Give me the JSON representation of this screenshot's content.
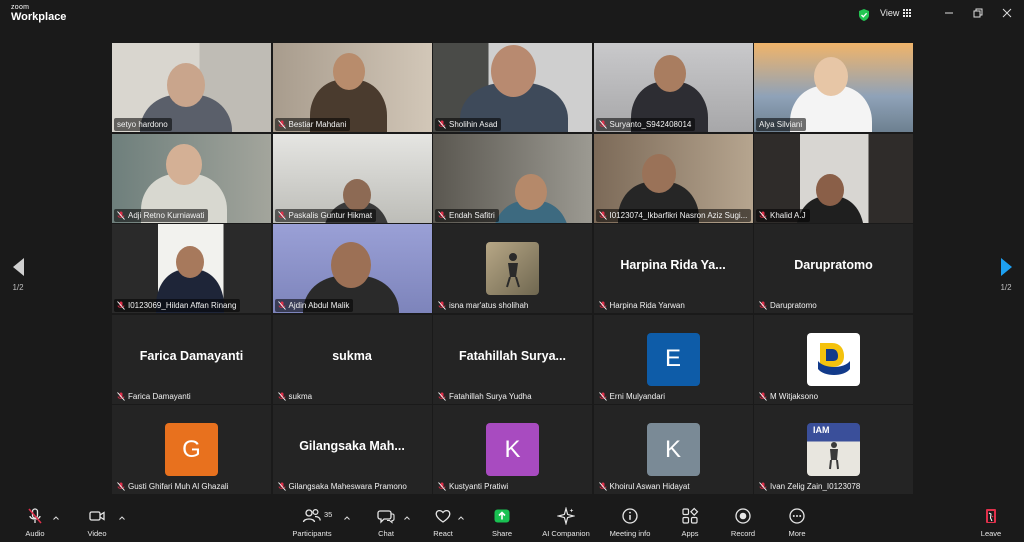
{
  "app": {
    "brand_small": "zoom",
    "brand_large": "Workplace",
    "view_label": "View"
  },
  "pager": {
    "left_label": "1/2",
    "right_label": "1/2"
  },
  "gallery": {
    "tiles": [
      {
        "name": "setyo hardono",
        "kind": "video",
        "muted": false,
        "bg": "#8a8a8a"
      },
      {
        "name": "Bestiar Mahdani",
        "kind": "video",
        "muted": true,
        "bg": "#7b6f62"
      },
      {
        "name": "Sholihin Asad",
        "kind": "video",
        "muted": true,
        "bg": "#6d6d6d"
      },
      {
        "name": "Suryanto_S942408014",
        "kind": "video",
        "muted": true,
        "bg": "#8d8d8f"
      },
      {
        "name": "Alya Silviani",
        "kind": "video",
        "muted": false,
        "bg": "#b9a27c",
        "active": true
      },
      {
        "name": "Adji Retno Kurniawati",
        "kind": "video",
        "muted": true,
        "bg": "#7a8a8a"
      },
      {
        "name": "Paskalis Guntur Hikmat",
        "kind": "video",
        "muted": true,
        "bg": "#8f8f8c"
      },
      {
        "name": "Endah Safitri",
        "kind": "video",
        "muted": true,
        "bg": "#6f6b63"
      },
      {
        "name": "I0123074_Ikbarfikri Nasron Aziz Sugi...",
        "kind": "video",
        "muted": true,
        "bg": "#5b4f45"
      },
      {
        "name": "Khalid A.J",
        "kind": "video",
        "muted": true,
        "bg": "#3a3633"
      },
      {
        "name": "I0123069_Hildan Affan Rinang",
        "kind": "video",
        "muted": true,
        "bg": "#2a2a2a"
      },
      {
        "name": "Ajdin Abdul Malik",
        "kind": "video",
        "muted": true,
        "bg": "#8a8fc2"
      },
      {
        "name": "isna mar'atus sholihah",
        "kind": "picture",
        "muted": true,
        "bg": "#242424"
      },
      {
        "name": "Harpina Rida Yarwan",
        "kind": "text",
        "muted": true,
        "display": "Harpina Rida Ya..."
      },
      {
        "name": "Darupratomo",
        "kind": "text",
        "muted": true,
        "display": "Darupratomo"
      },
      {
        "name": "Farica Damayanti",
        "kind": "text",
        "muted": true,
        "display": "Farica Damayanti"
      },
      {
        "name": "sukma",
        "kind": "text",
        "muted": true,
        "display": "sukma"
      },
      {
        "name": "Fatahillah Surya Yudha",
        "kind": "text",
        "muted": true,
        "display": "Fatahillah Surya..."
      },
      {
        "name": "Erni Mulyandari",
        "kind": "letter",
        "muted": true,
        "letter": "E",
        "color": "#0e5ca8"
      },
      {
        "name": "M Witjaksono",
        "kind": "logo",
        "muted": true
      },
      {
        "name": "Gusti Ghifari Muh Al Ghazali",
        "kind": "letter",
        "muted": true,
        "letter": "G",
        "color": "#e8711e"
      },
      {
        "name": "Gilangsaka Maheswara Pramono",
        "kind": "text",
        "muted": true,
        "display": "Gilangsaka Mah..."
      },
      {
        "name": "Kustyanti Pratiwi",
        "kind": "letter",
        "muted": true,
        "letter": "K",
        "color": "#a84bc0"
      },
      {
        "name": "Khoirul Aswan Hidayat",
        "kind": "letter",
        "muted": true,
        "letter": "K",
        "color": "#7a8a96"
      },
      {
        "name": "Ivan Zelig Zain_I0123078",
        "kind": "picture2",
        "muted": true
      }
    ]
  },
  "toolbar": {
    "audio": "Audio",
    "video": "Video",
    "participants": "Participants",
    "participants_count": "35",
    "chat": "Chat",
    "react": "React",
    "share": "Share",
    "ai_companion": "AI Companion",
    "meeting_info": "Meeting info",
    "apps": "Apps",
    "record": "Record",
    "more": "More",
    "leave": "Leave"
  },
  "colors": {
    "accent": "#1ea1f2",
    "active_speaker": "#2ed573",
    "share_green": "#19c152",
    "leave_red": "#e0304b",
    "muted_red": "#e0304b"
  }
}
